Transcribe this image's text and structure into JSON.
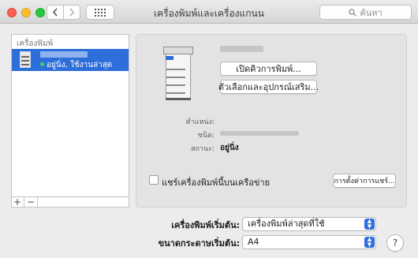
{
  "window": {
    "title": "เครื่องพิมพ์และเครื่องแกนน",
    "search_placeholder": "ค้นหา"
  },
  "sidebar": {
    "header": "เครื่องพิมพ์",
    "items": [
      {
        "status": "อยู่นิ่ง, ใช้งานล่าสุด",
        "status_color": "#3ed35a"
      }
    ],
    "add_label": "+",
    "remove_label": "−"
  },
  "detail": {
    "open_queue_label": "เปิดคิวการพิมพ์...",
    "options_label": "ตัวเลือกและอุปกรณ์เสริม...",
    "location_label": "ตำแหน่ง:",
    "kind_label": "ชนิด:",
    "status_label": "สถานะ:",
    "status_value": "อยู่นิ่ง",
    "share_label": "แชร์เครื่องพิมพ์นี้บนเครือข่าย",
    "share_checked": false,
    "share_settings_label": "การตั้งค่าการแชร์..."
  },
  "defaults": {
    "printer_label": "เครื่องพิมพ์เริ่มต้น:",
    "printer_value": "เครื่องพิมพ์ล่าสุดที่ใช้",
    "paper_label": "ขนาดกระดาษเริ่มต้น:",
    "paper_value": "A4"
  },
  "help_label": "?",
  "colors": {
    "accent": "#2d6edb",
    "close": "#fe5f57",
    "minimize": "#febc2e",
    "zoom": "#28c840"
  },
  "icons": {
    "back": "chevron-left-icon",
    "forward": "chevron-right-icon",
    "grid": "grid-icon",
    "search": "search-icon"
  }
}
